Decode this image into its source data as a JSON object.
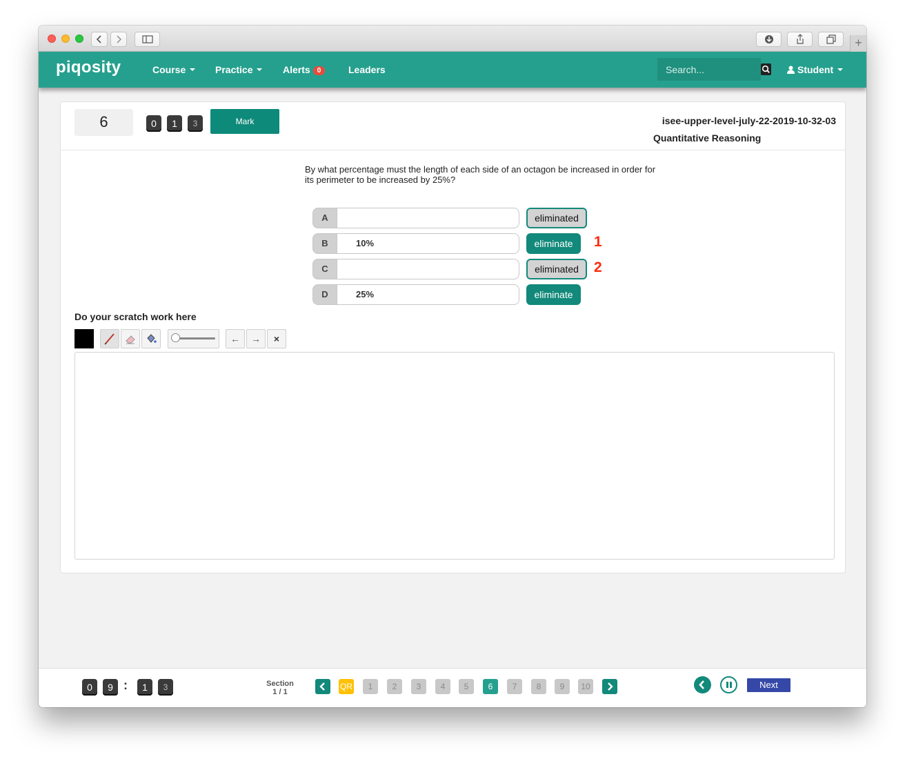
{
  "nav": {
    "brand": "piqosity",
    "course": "Course",
    "practice": "Practice",
    "alerts": "Alerts",
    "alerts_count": "0",
    "leaders": "Leaders",
    "search_placeholder": "Search...",
    "user": "Student"
  },
  "question": {
    "number": "6",
    "timer_digits": [
      "0",
      "1",
      "3"
    ],
    "mark_label": "Mark",
    "test_name": "isee-upper-level-july-22-2019-10-32-03",
    "section_name": "Quantitative Reasoning",
    "text": "By what percentage must the length of each side of an octagon be increased in order for its perimeter to be increased by 25%?",
    "choices": [
      {
        "letter": "A",
        "text": "",
        "button": "eliminated",
        "eliminated": true
      },
      {
        "letter": "B",
        "text": "10%",
        "button": "eliminate",
        "eliminated": false,
        "annotation": "1"
      },
      {
        "letter": "C",
        "text": "",
        "button": "eliminated",
        "eliminated": true,
        "annotation": "2"
      },
      {
        "letter": "D",
        "text": "25%",
        "button": "eliminate",
        "eliminated": false
      }
    ]
  },
  "scratch": {
    "label": "Do your scratch work here",
    "color": "#000000",
    "undo": "←",
    "redo": "→",
    "clear": "×"
  },
  "footer": {
    "timer": [
      "0",
      "9",
      "1",
      "3"
    ],
    "section_label": "Section",
    "section_value": "1 / 1",
    "pages": [
      "QR",
      "1",
      "2",
      "3",
      "4",
      "5",
      "6",
      "7",
      "8",
      "9",
      "10"
    ],
    "current_page": "6",
    "next_label": "Next"
  },
  "colors": {
    "brand": "#26a08e",
    "button": "#12897a",
    "annotation": "#ff2a0a",
    "next": "#3548a8",
    "qr": "#ffc107"
  }
}
